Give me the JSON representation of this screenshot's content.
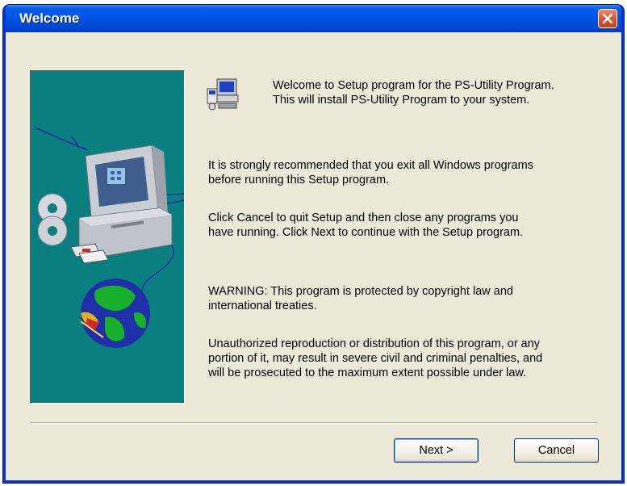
{
  "window": {
    "title": "Welcome",
    "close_icon": "close-icon"
  },
  "content": {
    "intro": "Welcome to Setup program for the PS-Utility Program.\nThis will install PS-Utility Program to your system.",
    "recommend": "It is strongly recommended that you exit all Windows programs\nbefore running this Setup program.",
    "instructions": "Click Cancel to quit Setup and then close any programs you\nhave running.  Click Next to continue with the Setup program.",
    "warning": "WARNING: This program is protected by copyright law and\ninternational treaties.",
    "penalty": "Unauthorized reproduction or distribution of this program, or any\nportion of it, may result in severe civil and criminal penalties, and\nwill be prosecuted to the maximum extent possible under law."
  },
  "buttons": {
    "next_label": "Next >",
    "cancel_label": "Cancel"
  },
  "colors": {
    "titlebar": "#0055e5",
    "panel": "#0a7f80",
    "dialog_bg": "#ece9d8",
    "close": "#e0532c"
  }
}
